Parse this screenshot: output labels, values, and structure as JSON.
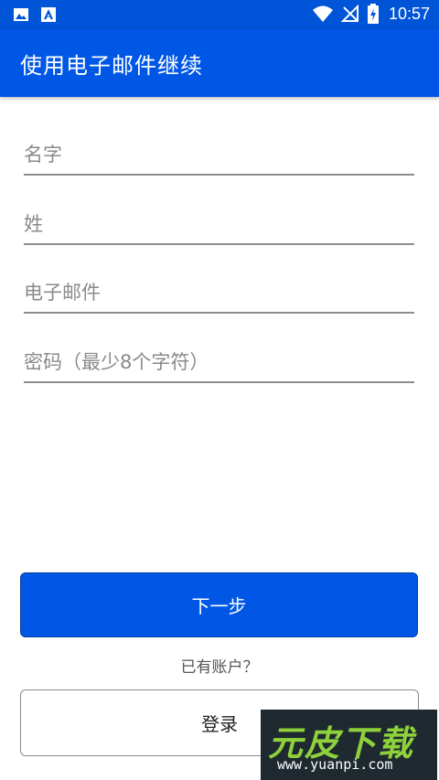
{
  "status_bar": {
    "time": "10:57",
    "icons": [
      "image-icon",
      "font-icon",
      "wifi-icon",
      "no-signal-icon",
      "battery-charging-icon"
    ]
  },
  "app_bar": {
    "title": "使用电子邮件继续"
  },
  "form": {
    "first_name_placeholder": "名字",
    "last_name_placeholder": "姓",
    "email_placeholder": "电子邮件",
    "password_placeholder": "密码（最少8个字符）"
  },
  "actions": {
    "next_label": "下一步",
    "have_account_text": "已有账户？",
    "login_label": "登录"
  },
  "watermark": {
    "brand": "元皮下载",
    "url": "www.yuanpi.com"
  },
  "colors": {
    "primary": "#0057e6",
    "status_bar": "#0054d8"
  }
}
